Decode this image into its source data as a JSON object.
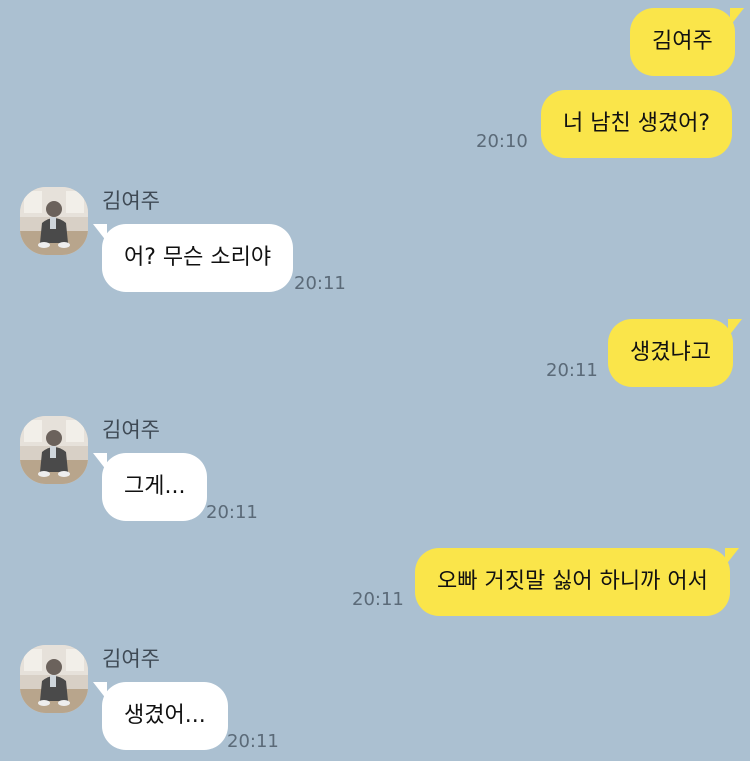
{
  "chat": {
    "messages": [
      {
        "direction": "out",
        "text": "김여주"
      },
      {
        "direction": "out",
        "text": "너 남친 생겼어?",
        "time": "20:10"
      },
      {
        "direction": "in",
        "sender": "김여주",
        "text": "어? 무슨 소리야",
        "time": "20:11"
      },
      {
        "direction": "out",
        "text": "생겼냐고",
        "time": "20:11"
      },
      {
        "direction": "in",
        "sender": "김여주",
        "text": "그게...",
        "time": "20:11"
      },
      {
        "direction": "out",
        "text": "오빠 거짓말 싫어 하니까 어서",
        "time": "20:11"
      },
      {
        "direction": "in",
        "sender": "김여주",
        "text": "생겼어...",
        "time": "20:11"
      }
    ]
  },
  "colors": {
    "background": "#abc0d1",
    "outgoing_bubble": "#fae54a",
    "incoming_bubble": "#ffffff"
  },
  "icons": {
    "avatar": "profile-photo-avatar"
  }
}
